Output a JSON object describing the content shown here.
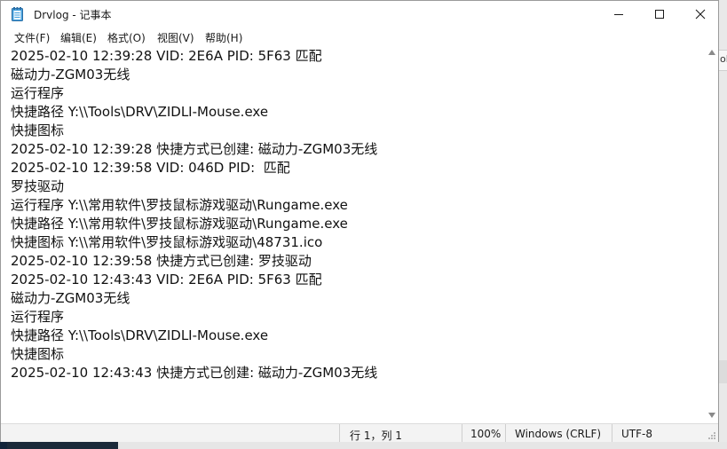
{
  "window": {
    "title": "Drvlog - 记事本"
  },
  "menu": [
    "文件(F)",
    "编辑(E)",
    "格式(O)",
    "视图(V)",
    "帮助(H)"
  ],
  "content": [
    "2025-02-10 12:39:28 VID: 2E6A PID: 5F63 匹配",
    "磁动力-ZGM03无线",
    "运行程序",
    "快捷路径 Y:\\\\Tools\\DRV\\ZIDLI-Mouse.exe",
    "快捷图标",
    "2025-02-10 12:39:28 快捷方式已创建: 磁动力-ZGM03无线",
    "2025-02-10 12:39:58 VID: 046D PID:  匹配",
    "罗技驱动",
    "运行程序 Y:\\\\常用软件\\罗技鼠标游戏驱动\\Rungame.exe",
    "快捷路径 Y:\\\\常用软件\\罗技鼠标游戏驱动\\Rungame.exe",
    "快捷图标 Y:\\\\常用软件\\罗技鼠标游戏驱动\\48731.ico",
    "2025-02-10 12:39:58 快捷方式已创建: 罗技驱动",
    "2025-02-10 12:43:43 VID: 2E6A PID: 5F63 匹配",
    "磁动力-ZGM03无线",
    "运行程序",
    "快捷路径 Y:\\\\Tools\\DRV\\ZIDLI-Mouse.exe",
    "快捷图标",
    "2025-02-10 12:43:43 快捷方式已创建: 磁动力-ZGM03无线"
  ],
  "status": {
    "position": "行 1，列 1",
    "zoom": "100%",
    "line_ending": "Windows (CRLF)",
    "encoding": "UTF-8"
  },
  "background": {
    "partial_text": "ol"
  }
}
